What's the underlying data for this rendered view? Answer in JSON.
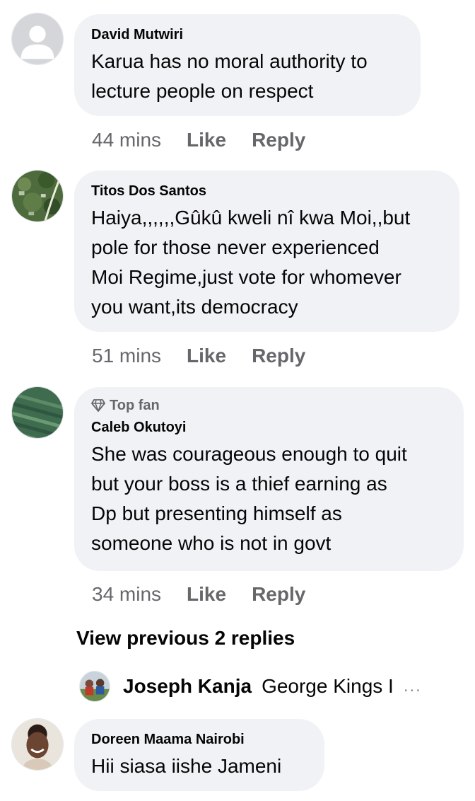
{
  "comments": [
    {
      "author": "David Mutwiri",
      "text": "Karua has no moral authority to lecture people on respect",
      "line1": "Karua has no moral authority to",
      "line2": "lecture people on respect",
      "time": "44 mins",
      "like": "Like",
      "reply": "Reply"
    },
    {
      "author": "Titos Dos Santos",
      "line1": "Haiya,,,,,,Gûkû kweli nî kwa Moi,,but",
      "line2": "pole for those never experienced",
      "line3": "Moi Regime,just vote for whomever",
      "line4": "you want,its democracy",
      "time": "51 mins",
      "like": "Like",
      "reply": "Reply"
    },
    {
      "badge": "Top fan",
      "badge_icon": "diamond-icon",
      "author": "Caleb Okutoyi",
      "line1": "She was courageous enough to quit",
      "line2": "but your boss is a thief earning as",
      "line3": "Dp but presenting himself as",
      "line4": "someone who is not in govt",
      "time": "34 mins",
      "like": "Like",
      "reply": "Reply"
    },
    {
      "author": "Doreen Maama Nairobi",
      "line1": "Hii siasa iishe Jameni"
    }
  ],
  "view_previous": "View previous 2 replies",
  "reply_preview": {
    "author": "Joseph Kanja",
    "text": "George Kings I",
    "ellipsis": "..."
  }
}
